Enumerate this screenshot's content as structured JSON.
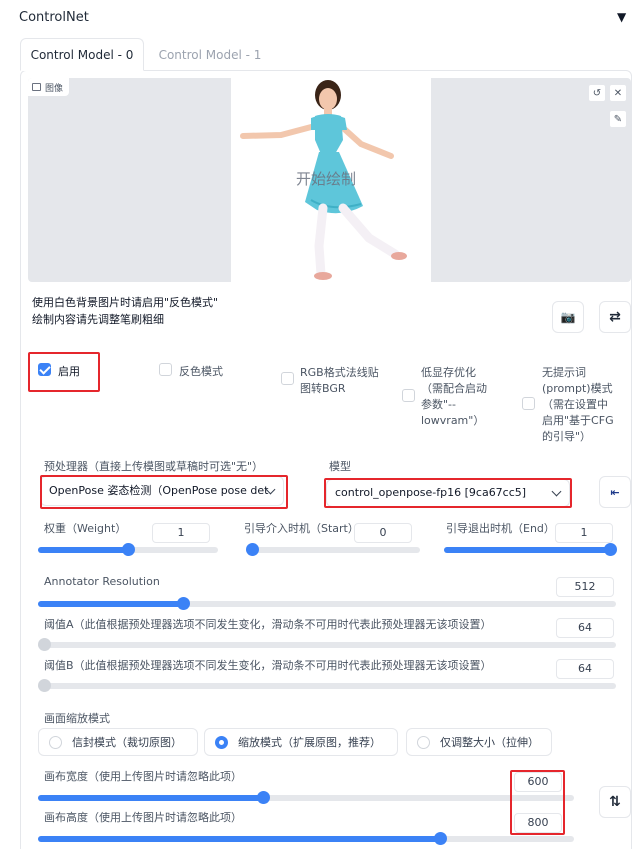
{
  "header": {
    "title": "ControlNet",
    "collapse_icon": "triangle-down-icon"
  },
  "tabs": [
    {
      "label": "Control Model - 0",
      "active": true
    },
    {
      "label": "Control Model - 1",
      "active": false
    }
  ],
  "canvas": {
    "image_label": "图像",
    "overlay_text": "开始绘制",
    "undo_icon": "undo-icon",
    "close_icon": "close-icon",
    "brush_icon": "brush-icon"
  },
  "hints": {
    "line1": "使用白色背景图片时请启用\"反色模式\"",
    "line2": "绘制内容请先调整笔刷粗细"
  },
  "buttons": {
    "camera_icon": "camera-icon",
    "swap_icon": "swap-icon",
    "send_icon": "send-end-icon",
    "updown_icon": "swap-vertical-icon"
  },
  "options": {
    "enable": {
      "label": "启用",
      "checked": true
    },
    "invert": {
      "label": "反色模式",
      "checked": false
    },
    "rgb_bgr": {
      "line1": "RGB格式法线贴",
      "line2": "图转BGR",
      "checked": false
    },
    "low_vram": {
      "line1": "低显存优化",
      "line2": "（需配合启动",
      "line3": "参数\"--",
      "line4": "lowvram\"）",
      "checked": false
    },
    "guess": {
      "line1": "无提示词",
      "line2": "(prompt)模式",
      "line3": "（需在设置中",
      "line4": "启用\"基于CFG",
      "line5": "的引导\"）",
      "checked": false
    }
  },
  "preprocessor": {
    "label": "预处理器（直接上传模图或草稿时可选\"无\"）",
    "value": "OpenPose 姿态检测（OpenPose pose det"
  },
  "model": {
    "label": "模型",
    "value": "control_openpose-fp16 [9ca67cc5]"
  },
  "sliders": {
    "weight": {
      "label": "权重（Weight）",
      "value": "1",
      "fraction": 0.5
    },
    "start": {
      "label": "引导介入时机（Start）",
      "value": "0",
      "fraction": 0.0
    },
    "end": {
      "label": "引导退出时机（End）",
      "value": "1",
      "fraction": 1.0
    },
    "annotator": {
      "label": "Annotator Resolution",
      "value": "512",
      "fraction": 0.25
    },
    "threshold_a": {
      "label": "阈值A（此值根据预处理器选项不同发生变化，滑动条不可用时代表此预处理器无该项设置）",
      "value": "64",
      "fraction": 0.0
    },
    "threshold_b": {
      "label": "阈值B（此值根据预处理器选项不同发生变化，滑动条不可用时代表此预处理器无该项设置）",
      "value": "64",
      "fraction": 0.0
    },
    "canvas_width": {
      "label": "画布宽度（使用上传图片时请忽略此项）",
      "value": "600",
      "fraction": 0.42
    },
    "canvas_height": {
      "label": "画布高度（使用上传图片时请忽略此项）",
      "value": "800",
      "fraction": 0.75
    }
  },
  "resize_mode": {
    "label": "画面缩放模式",
    "options": [
      {
        "label": "信封模式（裁切原图）",
        "selected": false
      },
      {
        "label": "缩放模式（扩展原图，推荐）",
        "selected": true
      },
      {
        "label": "仅调整大小（拉伸）",
        "selected": false
      }
    ]
  },
  "colors": {
    "accent": "#3b82f6",
    "highlight": "#e5262c",
    "dress": "#5ec6da"
  }
}
